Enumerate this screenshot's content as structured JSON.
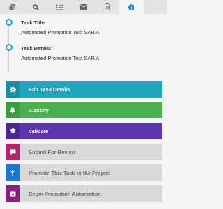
{
  "tabs": [
    {
      "icon": "documents-icon"
    },
    {
      "icon": "search-icon"
    },
    {
      "icon": "list-icon"
    },
    {
      "icon": "mail-icon"
    },
    {
      "icon": "file-x-icon"
    },
    {
      "icon": "info-icon"
    }
  ],
  "details": {
    "title_label": "Task Title:",
    "title_value": "Automated Promotion Test SAR A",
    "details_label": "Task Details:",
    "details_value": "Automated Promotion Test SAR A"
  },
  "actions": {
    "edit": {
      "label": "Edit Task Details",
      "color": "#1ea6bd",
      "icon_bg": "#178ea2"
    },
    "classify": {
      "label": "Classify",
      "color": "#4caf50",
      "icon_bg": "#3c9a3f"
    },
    "validate": {
      "label": "Validate",
      "color": "#5e35b1",
      "icon_bg": "#4a2794"
    },
    "submit": {
      "label": "Submit For Review",
      "icon_bg": "#b5236c"
    },
    "promote": {
      "label": "Promote This Task to the Project",
      "icon_bg": "#1976d2"
    },
    "begin": {
      "label": "Begin Promotion Automation",
      "icon_bg": "#8e1f80"
    }
  },
  "colors": {
    "accent": "#1ea5dd",
    "tab_bar": "#e3e3e3"
  }
}
